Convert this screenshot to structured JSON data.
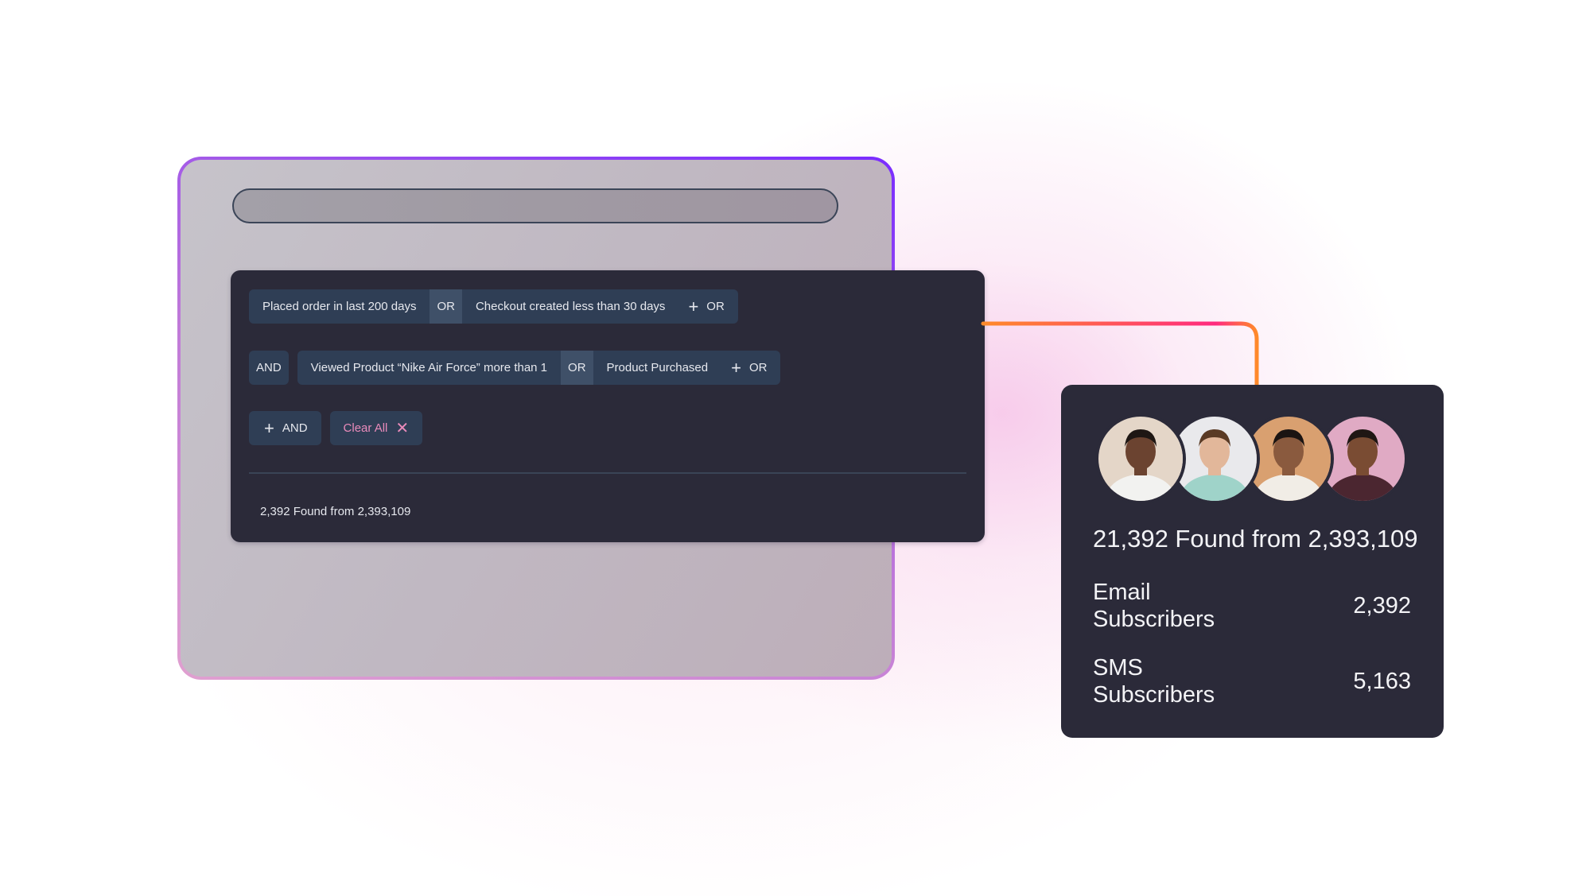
{
  "search": {
    "value": "",
    "placeholder": ""
  },
  "filters": {
    "row1": {
      "conditions": [
        "Placed order in last 200 days",
        "Checkout created less than 30 days"
      ],
      "joiner": "OR",
      "add_label": "OR"
    },
    "row2": {
      "prefix": "AND",
      "conditions": [
        "Viewed Product “Nike Air Force” more than 1",
        "Product Purchased"
      ],
      "joiner": "OR",
      "add_label": "OR"
    },
    "actions": {
      "add_and_label": "AND",
      "clear_all_label": "Clear All"
    },
    "result_text": "2,392 Found from 2,393,109"
  },
  "summary_card": {
    "avatars": [
      {
        "name": "avatar-1",
        "bg": "#e4d6c8",
        "skin": "#6b4330",
        "shirt": "#f2f2f0",
        "hair": "#1e1714"
      },
      {
        "name": "avatar-2",
        "bg": "#e9e9ec",
        "skin": "#e2b79a",
        "shirt": "#9fd3c9",
        "hair": "#5a3a24"
      },
      {
        "name": "avatar-3",
        "bg": "#d9a070",
        "skin": "#8a5a3e",
        "shirt": "#f1ede6",
        "hair": "#1b1412"
      },
      {
        "name": "avatar-4",
        "bg": "#e0aac4",
        "skin": "#7a4c33",
        "shirt": "#4b2630",
        "hair": "#1f1613"
      }
    ],
    "found_text": "21,392 Found from 2,393,109",
    "stats": [
      {
        "label": "Email Subscribers",
        "value": "2,392"
      },
      {
        "label": "SMS Subscribers",
        "value": "5,163"
      }
    ]
  },
  "colors": {
    "panel_bg": "#2b2a39",
    "chip_bg": "#2f3e55",
    "or_segment_bg": "#3f5068",
    "clear_all": "#ea8bbb",
    "connector_start": "#ff8a2a",
    "connector_end": "#ff2a7f",
    "frame_border_start": "#e0a0d0",
    "frame_border_end": "#7a2cff"
  }
}
